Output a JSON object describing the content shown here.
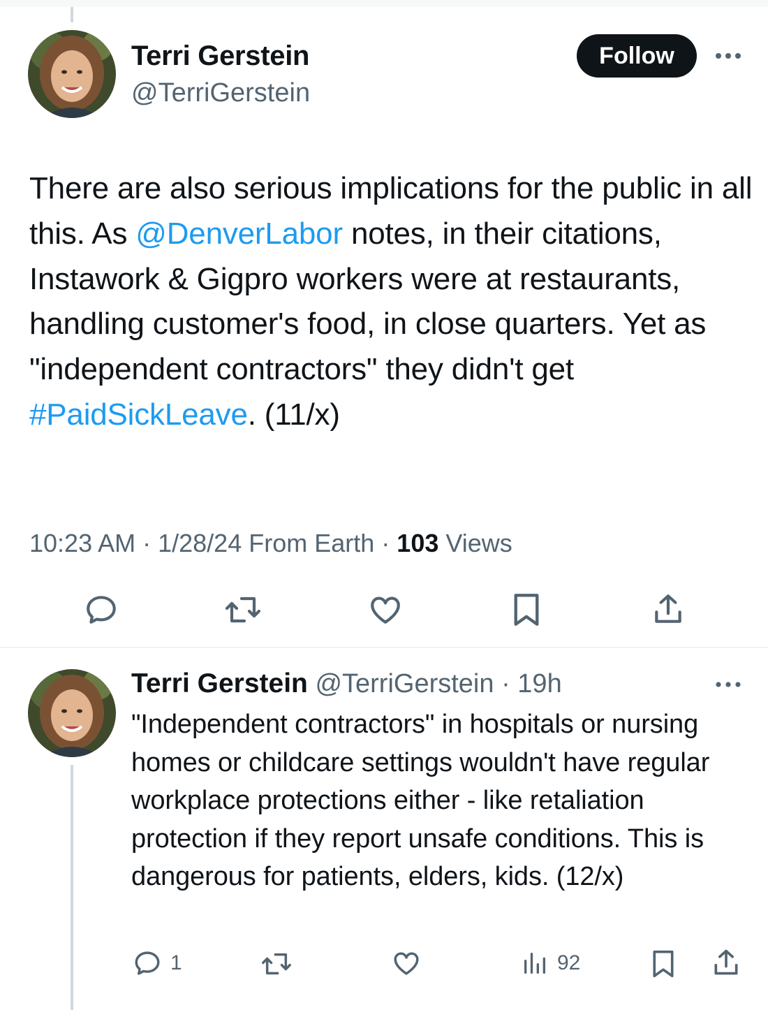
{
  "main_tweet": {
    "author_name": "Terri Gerstein",
    "author_handle": "@TerriGerstein",
    "follow_label": "Follow",
    "text_parts": {
      "p1": "There are also serious implications for the public in all this. As ",
      "mention": "@DenverLabor",
      "p2": " notes, in their citations, Instawork & Gigpro workers were at restaurants, handling customer's food, in close quarters. Yet as \"independent contractors\" they didn't get ",
      "hashtag": "#PaidSickLeave",
      "p3": ". (11/x)"
    },
    "meta": {
      "time": "10:23 AM",
      "date": "1/28/24",
      "source": "From Earth",
      "views_count": "103",
      "views_label": "Views"
    },
    "actions": [
      "reply-icon",
      "retweet-icon",
      "like-icon",
      "bookmark-icon",
      "share-icon"
    ]
  },
  "reply_tweet": {
    "author_name": "Terri Gerstein",
    "author_handle": "@TerriGerstein",
    "time_ago": "19h",
    "text": "\"Independent contractors\" in hospitals or nursing homes or childcare settings wouldn't have regular workplace protections either - like retaliation protection if they report unsafe conditions. This is dangerous for patients, elders, kids. (12/x)",
    "reply_count": "1",
    "views_count": "92",
    "actions": [
      "reply-icon",
      "retweet-icon",
      "like-icon",
      "views-icon",
      "bookmark-icon",
      "share-icon"
    ]
  },
  "colors": {
    "text": "#0f1419",
    "secondary": "#536471",
    "link": "#1d9bf0",
    "button_bg": "#0f1419",
    "thread_line": "#cfd9de"
  }
}
